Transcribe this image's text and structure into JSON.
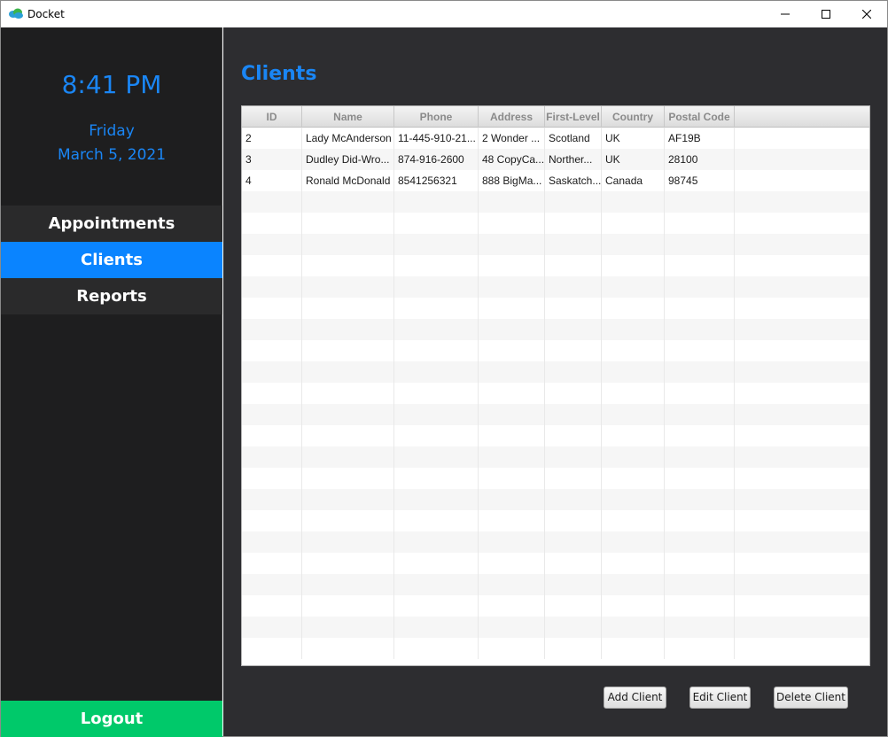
{
  "window": {
    "title": "Docket",
    "icon": "cloud-app-icon"
  },
  "sidebar": {
    "time": "8:41 PM",
    "day": "Friday",
    "date": "March 5, 2021",
    "nav": [
      {
        "label": "Appointments",
        "active": false
      },
      {
        "label": "Clients",
        "active": true
      },
      {
        "label": "Reports",
        "active": false
      }
    ],
    "logout_label": "Logout"
  },
  "main": {
    "title": "Clients",
    "table": {
      "columns": [
        "ID",
        "Name",
        "Phone",
        "Address",
        "First-Level",
        "Country",
        "Postal Code"
      ],
      "rows": [
        [
          "2",
          "Lady McAnderson",
          "11-445-910-21...",
          "2 Wonder ...",
          "Scotland",
          "UK",
          "AF19B"
        ],
        [
          "3",
          "Dudley Did-Wro...",
          "874-916-2600",
          "48 CopyCa...",
          "Norther...",
          "UK",
          "28100"
        ],
        [
          "4",
          "Ronald McDonald",
          "8541256321",
          "888 BigMa...",
          "Saskatch...",
          "Canada",
          "98745"
        ]
      ]
    },
    "buttons": {
      "add": "Add Client",
      "edit": "Edit Client",
      "delete": "Delete Client"
    }
  },
  "colors": {
    "accent_blue": "#1a86f5",
    "active_nav": "#0a84ff",
    "logout_green": "#00c96a",
    "sidebar_bg": "#1e1e1f",
    "main_bg": "#2d2d30"
  }
}
